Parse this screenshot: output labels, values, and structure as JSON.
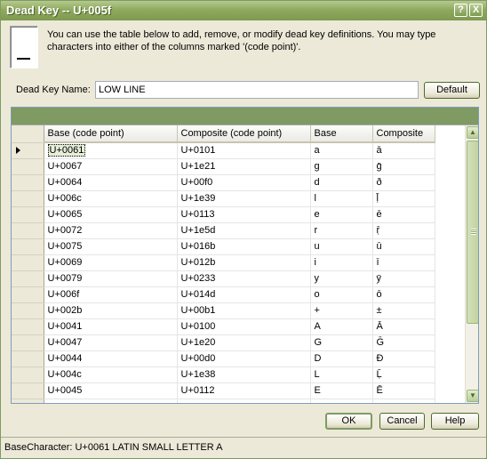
{
  "window": {
    "title": "Dead Key -- U+005f",
    "help_button": "?",
    "close_button": "X"
  },
  "description": "You can use the table below to add, remove, or modify dead key definitions.  You may type characters into either of the columns marked '(code point)'.",
  "dead_key": {
    "label": "Dead Key Name:",
    "value": "LOW LINE",
    "default_button": "Default"
  },
  "table": {
    "columns": [
      "Base  (code point)",
      "Composite (code point)",
      "Base",
      "Composite"
    ],
    "rows": [
      [
        "U+0061",
        "U+0101",
        "a",
        "ā"
      ],
      [
        "U+0067",
        "U+1e21",
        "g",
        "ḡ"
      ],
      [
        "U+0064",
        "U+00f0",
        "d",
        "ð"
      ],
      [
        "U+006c",
        "U+1e39",
        "l",
        "ḹ"
      ],
      [
        "U+0065",
        "U+0113",
        "e",
        "ē"
      ],
      [
        "U+0072",
        "U+1e5d",
        "r",
        "ṝ"
      ],
      [
        "U+0075",
        "U+016b",
        "u",
        "ū"
      ],
      [
        "U+0069",
        "U+012b",
        "i",
        "ī"
      ],
      [
        "U+0079",
        "U+0233",
        "y",
        "ȳ"
      ],
      [
        "U+006f",
        "U+014d",
        "o",
        "ō"
      ],
      [
        "U+002b",
        "U+00b1",
        "+",
        "±"
      ],
      [
        "U+0041",
        "U+0100",
        "A",
        "Ā"
      ],
      [
        "U+0047",
        "U+1e20",
        "G",
        "Ḡ"
      ],
      [
        "U+0044",
        "U+00d0",
        "D",
        "Đ"
      ],
      [
        "U+004c",
        "U+1e38",
        "L",
        "Ḹ"
      ],
      [
        "U+0045",
        "U+0112",
        "E",
        "Ē"
      ],
      [
        "",
        "",
        "",
        ""
      ]
    ]
  },
  "buttons": {
    "ok": "OK",
    "cancel": "Cancel",
    "help": "Help"
  },
  "status": "BaseCharacter: U+0061   LATIN SMALL LETTER A",
  "colors": {
    "titlebar": "#8faa5e",
    "caption": "#7f9a63",
    "face": "#ece9d8"
  }
}
